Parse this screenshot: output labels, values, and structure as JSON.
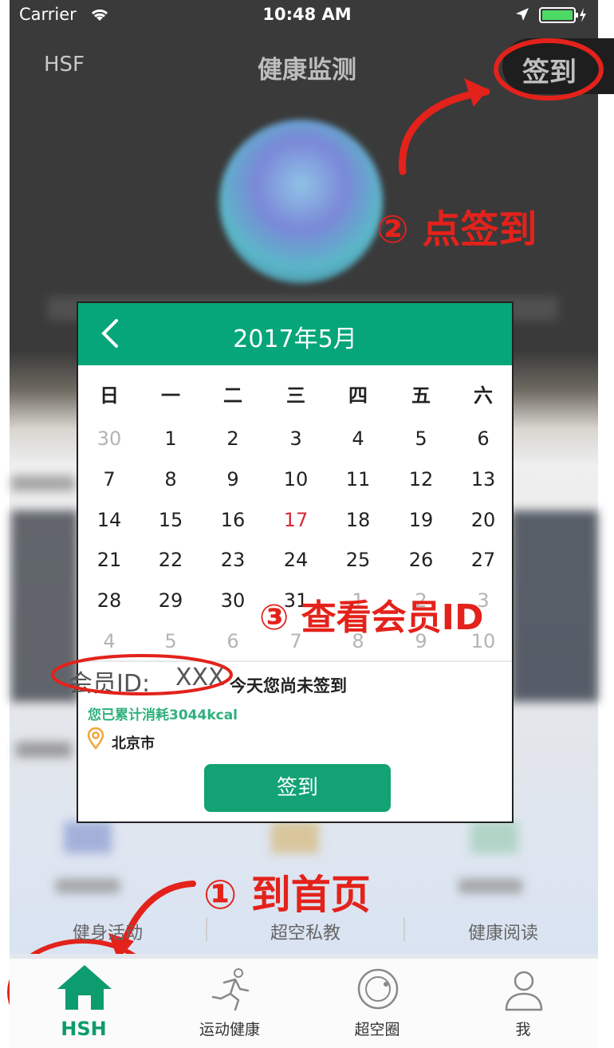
{
  "status_bar": {
    "carrier": "Carrier",
    "time": "10:48 AM"
  },
  "nav": {
    "left": "HSF",
    "title": "健康监测",
    "checkin": "签到"
  },
  "annotations": {
    "step2": "② 点签到",
    "step3": "③ 查看会员ID",
    "step1": "① 到首页"
  },
  "calendar": {
    "month": "2017年5月",
    "weekdays": [
      "日",
      "一",
      "二",
      "三",
      "四",
      "五",
      "六"
    ],
    "weeks": [
      [
        "30",
        "1",
        "2",
        "3",
        "4",
        "5",
        "6"
      ],
      [
        "7",
        "8",
        "9",
        "10",
        "11",
        "12",
        "13"
      ],
      [
        "14",
        "15",
        "16",
        "17",
        "18",
        "19",
        "20"
      ],
      [
        "21",
        "22",
        "23",
        "24",
        "25",
        "26",
        "27"
      ],
      [
        "28",
        "29",
        "30",
        "31",
        "1",
        "2",
        "3"
      ],
      [
        "4",
        "5",
        "6",
        "7",
        "8",
        "9",
        "10"
      ]
    ],
    "today": "17",
    "member_label": "会员ID:",
    "member_value": "XXX",
    "status": "今天您尚未签到",
    "calories": "您已累计消耗3044kcal",
    "location": "北京市",
    "sign_button": "签到"
  },
  "categories": [
    "健身活动",
    "超空私教",
    "健康阅读"
  ],
  "tabs": [
    {
      "label": "HSH",
      "icon": "home-icon"
    },
    {
      "label": "运动健康",
      "icon": "runner-icon"
    },
    {
      "label": "超空圈",
      "icon": "circle-icon"
    },
    {
      "label": "我",
      "icon": "user-icon"
    }
  ],
  "colors": {
    "accent": "#07a67a",
    "annotation": "#e3221b",
    "today": "#d9283a"
  }
}
